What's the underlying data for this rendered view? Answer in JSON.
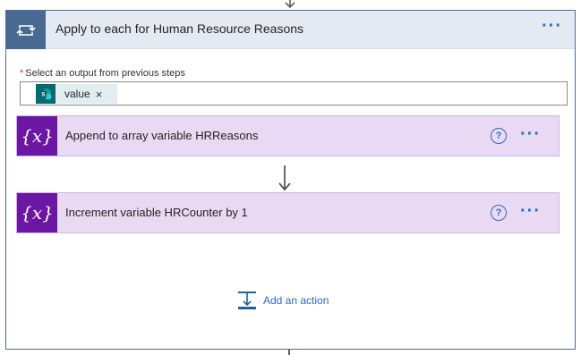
{
  "loop": {
    "title": "Apply to each for Human Resource Reasons",
    "icon": "loop-icon",
    "menu_label": "···"
  },
  "input": {
    "required_marker": "*",
    "label": "Select an output from previous steps",
    "token": {
      "icon": "sharepoint-icon",
      "label": "value",
      "remove_label": "×"
    }
  },
  "actions": [
    {
      "icon": "variable-icon",
      "icon_text": "{x}",
      "title": "Append to array variable HRReasons",
      "help_label": "?",
      "menu_label": "···"
    },
    {
      "icon": "variable-icon",
      "icon_text": "{x}",
      "title": "Increment variable HRCounter by 1",
      "help_label": "?",
      "menu_label": "···"
    }
  ],
  "add_action": {
    "icon": "add-action-icon",
    "label": "Add an action"
  },
  "colors": {
    "loop_header_bg": "#e5e9f2",
    "loop_icon_bg": "#486991",
    "action_bg": "#e9d9f2",
    "action_icon_bg": "#6c17a4",
    "accent_blue": "#2b6cc4",
    "sharepoint_teal": "#036c70"
  }
}
